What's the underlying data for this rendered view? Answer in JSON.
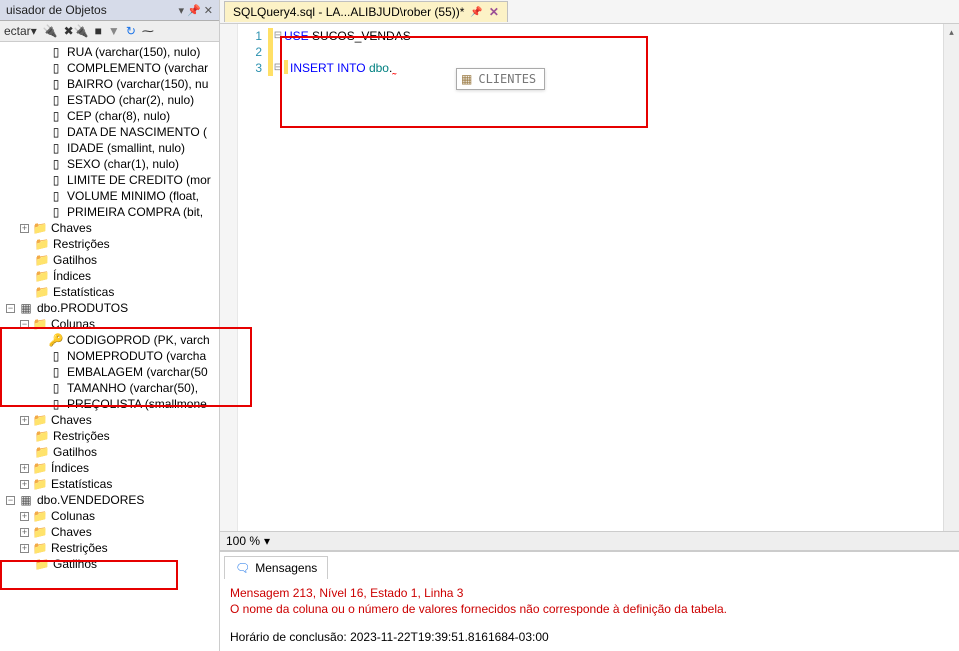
{
  "objectExplorer": {
    "title": "uisador de Objetos",
    "toolbar": {
      "connect": "ectar"
    },
    "columns": [
      "RUA (varchar(150), nulo)",
      "COMPLEMENTO (varchar",
      "BAIRRO (varchar(150), nu",
      "ESTADO (char(2), nulo)",
      "CEP (char(8), nulo)",
      "DATA DE NASCIMENTO (",
      "IDADE (smallint, nulo)",
      "SEXO (char(1), nulo)",
      "LIMITE DE CREDITO (mor",
      "VOLUME MINIMO (float,",
      "PRIMEIRA COMPRA (bit,"
    ],
    "folders1": [
      "Chaves",
      "Restrições",
      "Gatilhos",
      "Índices",
      "Estatísticas"
    ],
    "table2": "dbo.PRODUTOS",
    "table2_colunas": "Colunas",
    "table2_cols": [
      "CODIGOPROD (PK, varch",
      "NOMEPRODUTO (varcha",
      "EMBALAGEM (varchar(50",
      "TAMANHO (varchar(50),",
      "PREÇOLISTA (smallmone"
    ],
    "folders2": [
      "Chaves",
      "Restrições",
      "Gatilhos",
      "Índices",
      "Estatísticas"
    ],
    "table3": "dbo.VENDEDORES",
    "table3_colunas": "Colunas",
    "folders3": [
      "Chaves",
      "Restrições",
      "Gatilhos"
    ]
  },
  "tab": {
    "title": "SQLQuery4.sql - LA...ALIBJUD\\rober (55))*"
  },
  "code": {
    "line1": {
      "kw": "USE",
      "obj": "SUCOS_VENDAS"
    },
    "line3": {
      "kw1": "INSERT",
      "kw2": "INTO",
      "obj": "dbo",
      "dot": "."
    }
  },
  "intellisense": {
    "suggestion": "CLIENTES"
  },
  "zoom": {
    "value": "100 %"
  },
  "messages": {
    "tab": "Mensagens",
    "err1": "Mensagem 213, Nível 16, Estado 1, Linha 3",
    "err2": "O nome da coluna ou o número de valores fornecidos não corresponde à definição da tabela.",
    "done": "Horário de conclusão: 2023-11-22T19:39:51.8161684-03:00"
  }
}
